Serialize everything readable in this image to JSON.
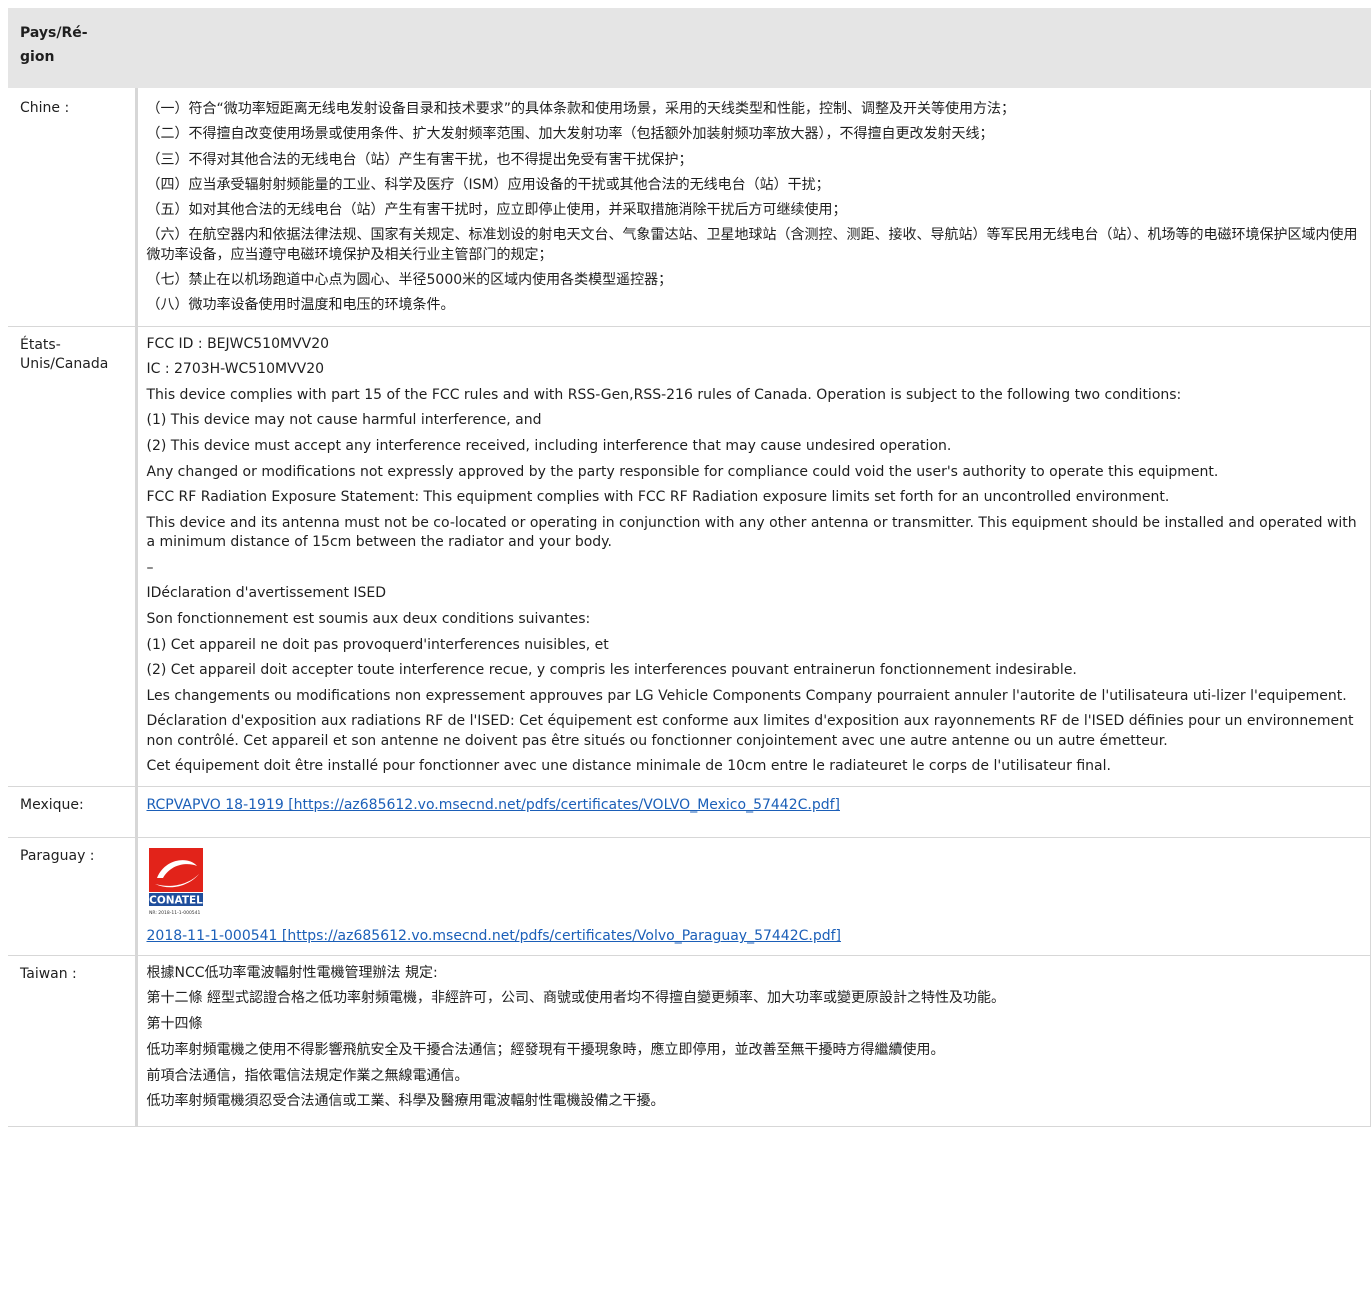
{
  "header": {
    "label": "Pays/Ré-\ngion"
  },
  "rows": {
    "chine": {
      "region": "Chine :",
      "lines": [
        "（一）符合“微功率短距离无线电发射设备目录和技术要求”的具体条款和使用场景，采用的天线类型和性能，控制、调整及开关等使用方法；",
        "（二）不得擅自改变使用场景或使用条件、扩大发射频率范围、加大发射功率（包括额外加装射频功率放大器），不得擅自更改发射天线；",
        "（三）不得对其他合法的无线电台（站）产生有害干扰，也不得提出免受有害干扰保护；",
        "（四）应当承受辐射射频能量的工业、科学及医疗（ISM）应用设备的干扰或其他合法的无线电台（站）干扰；",
        "（五）如对其他合法的无线电台（站）产生有害干扰时，应立即停止使用，并采取措施消除干扰后方可继续使用；",
        "（六）在航空器内和依据法律法规、国家有关规定、标准划设的射电天文台、气象雷达站、卫星地球站（含测控、测距、接收、导航站）等军民用无线电台（站）、机场等的电磁环境保护区域内使用微功率设备，应当遵守电磁环境保护及相关行业主管部门的规定；",
        "（七）禁止在以机场跑道中心点为圆心、半径5000米的区域内使用各类模型遥控器；",
        "（八）微功率设备使用时温度和电压的环境条件。"
      ]
    },
    "usa": {
      "region": "États-Unis/Canada",
      "lines": [
        "FCC ID : BEJWC510MVV20",
        "IC : 2703H-WC510MVV20",
        "This device complies with part 15 of the FCC rules and with RSS-Gen,RSS-216 rules of Canada. Operation is subject to the following two conditions:",
        "(1) This device may not cause harmful interference, and",
        "(2) This device must accept any interference received, including interference that may cause undesired operation.",
        "Any changed or modifications not expressly approved by the party responsible for compliance could void the user's authority to operate this equipment.",
        "FCC RF Radiation Exposure Statement: This equipment complies with FCC RF Radiation exposure limits set forth for an uncontrolled environment.",
        "This device and its antenna must not be co-located or operating in conjunction with any other antenna or transmitter. This equipment should be installed and operated with a minimum distance of 15cm between the radiator and your body.",
        "–",
        "IDéclaration d'avertissement ISED",
        "Son fonctionnement est soumis aux deux conditions suivantes:",
        "(1) Cet appareil ne doit pas provoquerd'interferences nuisibles, et",
        "(2) Cet appareil doit accepter toute interference recue, y compris les interferences pouvant entrainerun fonctionnement indesirable.",
        "Les changements ou modifications non expressement approuves par LG Vehicle Components Company pourraient annuler l'autorite de l'utilisateura uti-lizer l'equipement.",
        "Déclaration d'exposition aux radiations RF de l'ISED: Cet équipement est conforme aux limites d'exposition aux rayonnements RF de l'ISED définies pour un environnement non contrôlé. Cet appareil et son antenne ne doivent pas être situés ou fonctionner conjointement avec une autre antenne ou un autre émetteur.",
        "Cet équipement doit être installé pour fonctionner avec une distance minimale de 10cm entre le radiateuret le corps de l'utilisateur final."
      ]
    },
    "mexique": {
      "region": "Mexique:",
      "link": "RCPVAPVO 18-1919 [https://az685612.vo.msecnd.net/pdfs/certificates/VOLVO_Mexico_57442C.pdf]"
    },
    "paraguay": {
      "region": "Paraguay :",
      "logo_text": "CONATEL",
      "logo_nr": "NR: 2018-11-1-000541",
      "logo_colors": {
        "red": "#e2231a",
        "blue": "#1f4e9c"
      },
      "link": "2018-11-1-000541 [https://az685612.vo.msecnd.net/pdfs/certificates/Volvo_Paraguay_57442C.pdf]"
    },
    "taiwan": {
      "region": "Taiwan :",
      "lines": [
        "根據NCC低功率電波輻射性電機管理辦法 規定:",
        "第十二條 經型式認證合格之低功率射頻電機，非經許可，公司、商號或使用者均不得擅自變更頻率、加大功率或變更原設計之特性及功能。",
        "第十四條",
        "低功率射頻電機之使用不得影響飛航安全及干擾合法通信；經發現有干擾現象時，應立即停用，並改善至無干擾時方得繼續使用。",
        "前項合法通信，指依電信法規定作業之無線電通信。",
        "低功率射頻電機須忍受合法通信或工業、科學及醫療用電波輻射性電機設備之干擾。"
      ]
    }
  }
}
